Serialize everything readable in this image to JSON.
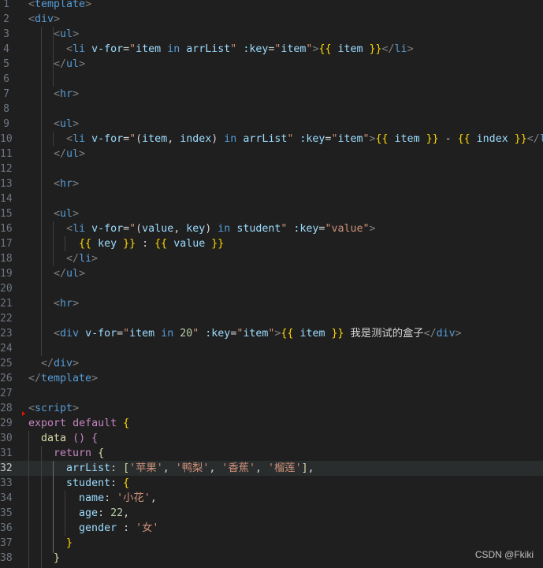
{
  "colors": {
    "background": "#1f1f1f",
    "tag": "#569cd6",
    "bracket": "#808080",
    "attribute": "#9cdcfe",
    "string": "#ce9178",
    "mustache": "#ffd700",
    "keyword": "#569cd6",
    "control": "#c586c0",
    "text": "#d4d4d4",
    "number": "#b5cea8",
    "function": "#dcdcaa"
  },
  "editor": {
    "active_line": 32,
    "lines": [
      {
        "n": "1",
        "tokens": [
          [
            "b",
            "<"
          ],
          [
            "t",
            "template"
          ],
          [
            "b",
            ">"
          ]
        ]
      },
      {
        "n": "2",
        "tokens": [
          [
            "b",
            "<"
          ],
          [
            "t",
            "div"
          ],
          [
            "b",
            ">"
          ]
        ]
      },
      {
        "n": "3",
        "tokens": [
          [
            "x",
            "    "
          ],
          [
            "b",
            "<"
          ],
          [
            "t",
            "ul"
          ],
          [
            "b",
            ">"
          ]
        ]
      },
      {
        "n": "4",
        "tokens": [
          [
            "x",
            "      "
          ],
          [
            "b",
            "<"
          ],
          [
            "t",
            "li"
          ],
          [
            "x",
            " "
          ],
          [
            "a",
            "v-for"
          ],
          [
            "x",
            "="
          ],
          [
            "s",
            "\""
          ],
          [
            "a",
            "item"
          ],
          [
            "x",
            " "
          ],
          [
            "k",
            "in"
          ],
          [
            "x",
            " "
          ],
          [
            "a",
            "arrList"
          ],
          [
            "s",
            "\""
          ],
          [
            "x",
            " "
          ],
          [
            "a",
            ":key"
          ],
          [
            "x",
            "="
          ],
          [
            "s",
            "\""
          ],
          [
            "a",
            "item"
          ],
          [
            "s",
            "\""
          ],
          [
            "b",
            ">"
          ],
          [
            "m",
            "{{"
          ],
          [
            "x",
            " "
          ],
          [
            "a",
            "item"
          ],
          [
            "x",
            " "
          ],
          [
            "m",
            "}}"
          ],
          [
            "b",
            "</"
          ],
          [
            "t",
            "li"
          ],
          [
            "b",
            ">"
          ]
        ]
      },
      {
        "n": "5",
        "tokens": [
          [
            "x",
            "    "
          ],
          [
            "b",
            "</"
          ],
          [
            "t",
            "ul"
          ],
          [
            "b",
            ">"
          ]
        ]
      },
      {
        "n": "6",
        "tokens": []
      },
      {
        "n": "7",
        "tokens": [
          [
            "x",
            "    "
          ],
          [
            "b",
            "<"
          ],
          [
            "t",
            "hr"
          ],
          [
            "b",
            ">"
          ]
        ]
      },
      {
        "n": "8",
        "tokens": []
      },
      {
        "n": "9",
        "tokens": [
          [
            "x",
            "    "
          ],
          [
            "b",
            "<"
          ],
          [
            "t",
            "ul"
          ],
          [
            "b",
            ">"
          ]
        ]
      },
      {
        "n": "10",
        "tokens": [
          [
            "x",
            "      "
          ],
          [
            "b",
            "<"
          ],
          [
            "t",
            "li"
          ],
          [
            "x",
            " "
          ],
          [
            "a",
            "v-for"
          ],
          [
            "x",
            "="
          ],
          [
            "s",
            "\""
          ],
          [
            "x",
            "("
          ],
          [
            "a",
            "item"
          ],
          [
            "x",
            ", "
          ],
          [
            "a",
            "index"
          ],
          [
            "x",
            ")"
          ],
          [
            "x",
            " "
          ],
          [
            "k",
            "in"
          ],
          [
            "x",
            " "
          ],
          [
            "a",
            "arrList"
          ],
          [
            "s",
            "\""
          ],
          [
            "x",
            " "
          ],
          [
            "a",
            ":key"
          ],
          [
            "x",
            "="
          ],
          [
            "s",
            "\""
          ],
          [
            "a",
            "item"
          ],
          [
            "s",
            "\""
          ],
          [
            "b",
            ">"
          ],
          [
            "m",
            "{{"
          ],
          [
            "x",
            " "
          ],
          [
            "a",
            "item"
          ],
          [
            "x",
            " "
          ],
          [
            "m",
            "}}"
          ],
          [
            "x",
            " - "
          ],
          [
            "m",
            "{{"
          ],
          [
            "x",
            " "
          ],
          [
            "a",
            "index"
          ],
          [
            "x",
            " "
          ],
          [
            "m",
            "}}"
          ],
          [
            "b",
            "</"
          ],
          [
            "t",
            "li"
          ],
          [
            "b",
            ">"
          ]
        ]
      },
      {
        "n": "11",
        "tokens": [
          [
            "x",
            "    "
          ],
          [
            "b",
            "</"
          ],
          [
            "t",
            "ul"
          ],
          [
            "b",
            ">"
          ]
        ]
      },
      {
        "n": "12",
        "tokens": []
      },
      {
        "n": "13",
        "tokens": [
          [
            "x",
            "    "
          ],
          [
            "b",
            "<"
          ],
          [
            "t",
            "hr"
          ],
          [
            "b",
            ">"
          ]
        ]
      },
      {
        "n": "14",
        "tokens": []
      },
      {
        "n": "15",
        "tokens": [
          [
            "x",
            "    "
          ],
          [
            "b",
            "<"
          ],
          [
            "t",
            "ul"
          ],
          [
            "b",
            ">"
          ]
        ]
      },
      {
        "n": "16",
        "tokens": [
          [
            "x",
            "      "
          ],
          [
            "b",
            "<"
          ],
          [
            "t",
            "li"
          ],
          [
            "x",
            " "
          ],
          [
            "a",
            "v-for"
          ],
          [
            "x",
            "="
          ],
          [
            "s",
            "\""
          ],
          [
            "x",
            "("
          ],
          [
            "a",
            "value"
          ],
          [
            "x",
            ", "
          ],
          [
            "a",
            "key"
          ],
          [
            "x",
            ")"
          ],
          [
            "x",
            " "
          ],
          [
            "k",
            "in"
          ],
          [
            "x",
            " "
          ],
          [
            "a",
            "student"
          ],
          [
            "s",
            "\""
          ],
          [
            "x",
            " "
          ],
          [
            "a",
            ":key"
          ],
          [
            "x",
            "="
          ],
          [
            "s",
            "\"value\""
          ],
          [
            "b",
            ">"
          ]
        ]
      },
      {
        "n": "17",
        "tokens": [
          [
            "x",
            "        "
          ],
          [
            "m",
            "{{"
          ],
          [
            "x",
            " "
          ],
          [
            "a",
            "key"
          ],
          [
            "x",
            " "
          ],
          [
            "m",
            "}}"
          ],
          [
            "x",
            " : "
          ],
          [
            "m",
            "{{"
          ],
          [
            "x",
            " "
          ],
          [
            "a",
            "value"
          ],
          [
            "x",
            " "
          ],
          [
            "m",
            "}}"
          ]
        ]
      },
      {
        "n": "18",
        "tokens": [
          [
            "x",
            "      "
          ],
          [
            "b",
            "</"
          ],
          [
            "t",
            "li"
          ],
          [
            "b",
            ">"
          ]
        ]
      },
      {
        "n": "19",
        "tokens": [
          [
            "x",
            "    "
          ],
          [
            "b",
            "</"
          ],
          [
            "t",
            "ul"
          ],
          [
            "b",
            ">"
          ]
        ]
      },
      {
        "n": "20",
        "tokens": []
      },
      {
        "n": "21",
        "tokens": [
          [
            "x",
            "    "
          ],
          [
            "b",
            "<"
          ],
          [
            "t",
            "hr"
          ],
          [
            "b",
            ">"
          ]
        ]
      },
      {
        "n": "22",
        "tokens": []
      },
      {
        "n": "23",
        "tokens": [
          [
            "x",
            "    "
          ],
          [
            "b",
            "<"
          ],
          [
            "t",
            "div"
          ],
          [
            "x",
            " "
          ],
          [
            "a",
            "v-for"
          ],
          [
            "x",
            "="
          ],
          [
            "s",
            "\""
          ],
          [
            "a",
            "item"
          ],
          [
            "x",
            " "
          ],
          [
            "k",
            "in"
          ],
          [
            "x",
            " "
          ],
          [
            "n",
            "20"
          ],
          [
            "s",
            "\""
          ],
          [
            "x",
            " "
          ],
          [
            "a",
            ":key"
          ],
          [
            "x",
            "="
          ],
          [
            "s",
            "\""
          ],
          [
            "a",
            "item"
          ],
          [
            "s",
            "\""
          ],
          [
            "b",
            ">"
          ],
          [
            "m",
            "{{"
          ],
          [
            "x",
            " "
          ],
          [
            "a",
            "item"
          ],
          [
            "x",
            " "
          ],
          [
            "m",
            "}}"
          ],
          [
            "x",
            " 我是测试的盒子"
          ],
          [
            "b",
            "</"
          ],
          [
            "t",
            "div"
          ],
          [
            "b",
            ">"
          ]
        ]
      },
      {
        "n": "24",
        "tokens": []
      },
      {
        "n": "25",
        "tokens": [
          [
            "x",
            "  "
          ],
          [
            "b",
            "</"
          ],
          [
            "t",
            "div"
          ],
          [
            "b",
            ">"
          ]
        ]
      },
      {
        "n": "26",
        "tokens": [
          [
            "b",
            "</"
          ],
          [
            "t",
            "template"
          ],
          [
            "b",
            ">"
          ]
        ]
      },
      {
        "n": "27",
        "tokens": []
      },
      {
        "n": "28",
        "tokens": [
          [
            "b",
            "<"
          ],
          [
            "t",
            "script"
          ],
          [
            "b",
            ">"
          ]
        ]
      },
      {
        "n": "29",
        "tokens": [
          [
            "c",
            "export"
          ],
          [
            "x",
            " "
          ],
          [
            "c",
            "default"
          ],
          [
            "x",
            " "
          ],
          [
            "m",
            "{"
          ]
        ]
      },
      {
        "n": "30",
        "tokens": [
          [
            "x",
            "  "
          ],
          [
            "f",
            "data"
          ],
          [
            "x",
            " "
          ],
          [
            "p",
            "()"
          ],
          [
            "x",
            " "
          ],
          [
            "p",
            "{"
          ]
        ]
      },
      {
        "n": "31",
        "tokens": [
          [
            "x",
            "    "
          ],
          [
            "c",
            "return"
          ],
          [
            "x",
            " "
          ],
          [
            "h",
            "{"
          ]
        ]
      },
      {
        "n": "32",
        "tokens": [
          [
            "x",
            "      "
          ],
          [
            "a",
            "arrList"
          ],
          [
            "x",
            ": "
          ],
          [
            "h",
            "["
          ],
          [
            "s",
            "'苹果'"
          ],
          [
            "x",
            ", "
          ],
          [
            "s",
            "'鸭梨'"
          ],
          [
            "x",
            ", "
          ],
          [
            "s",
            "'香蕉'"
          ],
          [
            "x",
            ", "
          ],
          [
            "s",
            "'榴莲'"
          ],
          [
            "h",
            "]"
          ],
          [
            "x",
            ","
          ]
        ]
      },
      {
        "n": "33",
        "tokens": [
          [
            "x",
            "      "
          ],
          [
            "a",
            "student"
          ],
          [
            "x",
            ": "
          ],
          [
            "m",
            "{"
          ]
        ]
      },
      {
        "n": "34",
        "tokens": [
          [
            "x",
            "        "
          ],
          [
            "a",
            "name"
          ],
          [
            "x",
            ": "
          ],
          [
            "s",
            "'小花'"
          ],
          [
            "x",
            ","
          ]
        ]
      },
      {
        "n": "35",
        "tokens": [
          [
            "x",
            "        "
          ],
          [
            "a",
            "age"
          ],
          [
            "x",
            ": "
          ],
          [
            "n",
            "22"
          ],
          [
            "x",
            ","
          ]
        ]
      },
      {
        "n": "36",
        "tokens": [
          [
            "x",
            "        "
          ],
          [
            "a",
            "gender"
          ],
          [
            "x",
            " : "
          ],
          [
            "s",
            "'女'"
          ]
        ]
      },
      {
        "n": "37",
        "tokens": [
          [
            "x",
            "      "
          ],
          [
            "m",
            "}"
          ]
        ]
      },
      {
        "n": "38",
        "tokens": [
          [
            "x",
            "    "
          ],
          [
            "h",
            "}"
          ]
        ]
      }
    ]
  },
  "watermark": "CSDN @Fkiki"
}
